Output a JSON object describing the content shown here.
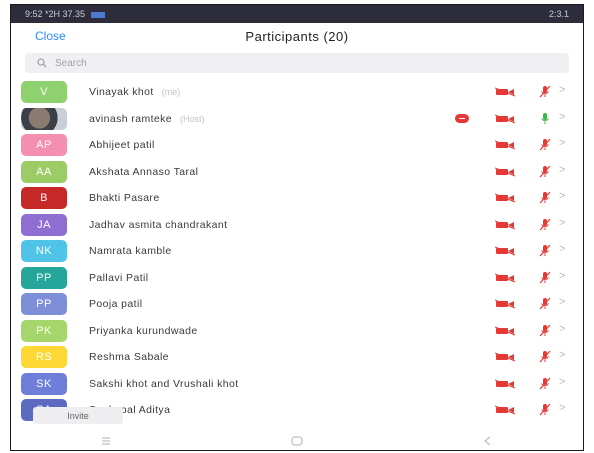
{
  "status_bar": {
    "left_text": "9:52 *2H 37.35",
    "right_text": "2:3.1"
  },
  "header": {
    "close_label": "Close",
    "title": "Participants (20)"
  },
  "search": {
    "placeholder": "Search"
  },
  "colors": {
    "accent": "#2d8cff",
    "muted_icon": "#e53935",
    "unmuted_icon": "#3cb64a"
  },
  "participants": [
    {
      "initials": "V",
      "name": "Vinayak  khot",
      "tag": "(me)",
      "avatar_color": "#8fd16e",
      "hand_raised": false,
      "mic": "muted"
    },
    {
      "initials": "",
      "name": "avinash ramteke",
      "tag": "(Host)",
      "avatar_color": "photo",
      "hand_raised": true,
      "mic": "unmuted"
    },
    {
      "initials": "AP",
      "name": "Abhijeet patil",
      "tag": "",
      "avatar_color": "#f48fb1",
      "hand_raised": false,
      "mic": "muted"
    },
    {
      "initials": "AA",
      "name": "Akshata Annaso Taral",
      "tag": "",
      "avatar_color": "#9ccc65",
      "hand_raised": false,
      "mic": "muted"
    },
    {
      "initials": "B",
      "name": "Bhakti Pasare",
      "tag": "",
      "avatar_color": "#c62828",
      "hand_raised": false,
      "mic": "muted"
    },
    {
      "initials": "JA",
      "name": "Jadhav asmita chandrakant",
      "tag": "",
      "avatar_color": "#8e6ed1",
      "hand_raised": false,
      "mic": "muted"
    },
    {
      "initials": "NK",
      "name": "Namrata kamble",
      "tag": "",
      "avatar_color": "#4fc3e8",
      "hand_raised": false,
      "mic": "muted"
    },
    {
      "initials": "PP",
      "name": "Pallavi Patil",
      "tag": "",
      "avatar_color": "#26a69a",
      "hand_raised": false,
      "mic": "muted"
    },
    {
      "initials": "PP",
      "name": "Pooja patil",
      "tag": "",
      "avatar_color": "#7e8ed8",
      "hand_raised": false,
      "mic": "muted"
    },
    {
      "initials": "PK",
      "name": "Priyanka kurundwade",
      "tag": "",
      "avatar_color": "#a5d66b",
      "hand_raised": false,
      "mic": "muted"
    },
    {
      "initials": "RS",
      "name": "Reshma Sabale",
      "tag": "",
      "avatar_color": "#fdd835",
      "hand_raised": false,
      "mic": "muted"
    },
    {
      "initials": "SK",
      "name": "Sakshi khot and Vrushali khot",
      "tag": "",
      "avatar_color": "#6f7fd9",
      "hand_raised": false,
      "mic": "muted"
    },
    {
      "initials": "SA",
      "name": "Sankapal Aditya",
      "tag": "",
      "avatar_color": "#5c6bc0",
      "hand_raised": false,
      "mic": "muted"
    }
  ],
  "footer": {
    "invite_label": "Invite"
  },
  "nav_icons": [
    "recent-apps-icon",
    "home-icon",
    "back-icon"
  ]
}
